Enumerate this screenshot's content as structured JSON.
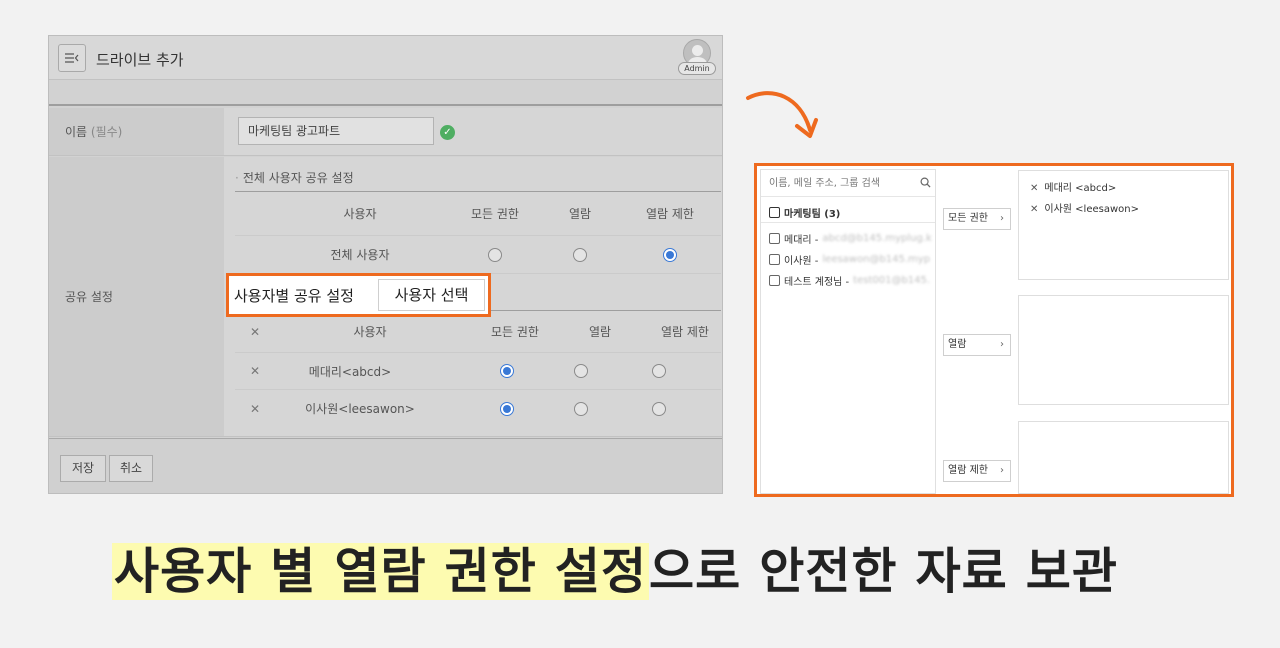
{
  "app": {
    "title": "드라이브 추가",
    "avatar_badge": "Admin",
    "name_field": {
      "label": "이름",
      "required": "(필수)",
      "value": "마케팅팀 광고파트"
    },
    "share_label": "공유 설정",
    "all_share": {
      "title": "전체 사용자 공유 설정",
      "headers": [
        "사용자",
        "모든 권한",
        "열람",
        "열람 제한"
      ],
      "row": {
        "user": "전체 사용자",
        "selected": "열람 제한"
      }
    },
    "user_share": {
      "title": "사용자별 공유 설정",
      "select_button": "사용자 선택",
      "headers": [
        "사용자",
        "모든 권한",
        "열람",
        "열람 제한"
      ],
      "rows": [
        {
          "user": "메대리<abcd>",
          "selected": "모든 권한"
        },
        {
          "user": "이사원<leesawon>",
          "selected": "모든 권한"
        }
      ]
    },
    "footer": {
      "save": "저장",
      "cancel": "취소"
    }
  },
  "panel": {
    "search_placeholder": "이름, 메일 주소, 그룹 검색",
    "group": "마케팅팀 (3)",
    "members": [
      {
        "name": "메대리 -",
        "email": "abcd@b145.myplug.k"
      },
      {
        "name": "이사원 -",
        "email": "leesawon@b145.myp"
      },
      {
        "name": "테스트 계정님 -",
        "email": "test001@b145."
      }
    ],
    "buttons": [
      "모든 권한",
      "열람",
      "열람 제한"
    ],
    "selected_all_permission": [
      "메대리 <abcd>",
      "이사원 <leesawon>"
    ]
  },
  "caption": {
    "highlight": "사용자 별 열람 권한 설정",
    "rest": "으로 안전한 자료 보관"
  },
  "colors": {
    "accent": "#ee6a1f",
    "highlight": "#fdfbb0",
    "radio_on": "#3a79d6",
    "check": "#4fae62"
  }
}
